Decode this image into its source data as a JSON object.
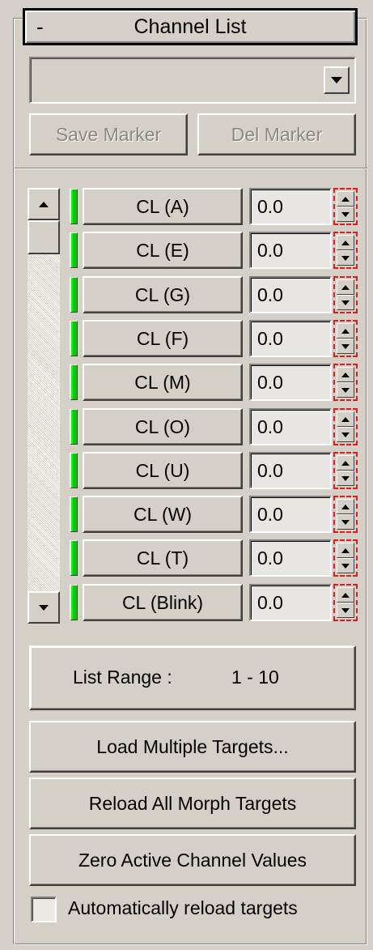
{
  "rollout": {
    "collapse_symbol": "-",
    "title": "Channel List"
  },
  "marker": {
    "selected": "",
    "save_label": "Save Marker",
    "delete_label": "Del Marker"
  },
  "channels": [
    {
      "label": "CL (A)",
      "value": "0.0",
      "active": true
    },
    {
      "label": "CL (E)",
      "value": "0.0",
      "active": true
    },
    {
      "label": "CL (G)",
      "value": "0.0",
      "active": true
    },
    {
      "label": "CL (F)",
      "value": "0.0",
      "active": true
    },
    {
      "label": "CL (M)",
      "value": "0.0",
      "active": true
    },
    {
      "label": "CL (O)",
      "value": "0.0",
      "active": true
    },
    {
      "label": "CL (U)",
      "value": "0.0",
      "active": true
    },
    {
      "label": "CL (W)",
      "value": "0.0",
      "active": true
    },
    {
      "label": "CL (T)",
      "value": "0.0",
      "active": true
    },
    {
      "label": "CL (Blink)",
      "value": "0.0",
      "active": true
    }
  ],
  "range": {
    "label": "List Range :",
    "value": "1 - 10"
  },
  "actions": {
    "load_multiple": "Load Multiple Targets...",
    "reload_all": "Reload All Morph Targets",
    "zero_active": "Zero Active Channel Values"
  },
  "auto_reload": {
    "label": "Automatically reload targets",
    "checked": false
  },
  "colors": {
    "active_indicator": "#00cc00",
    "spinner_outline": "#e01b1b",
    "panel_bg": "#d4d0c8"
  }
}
